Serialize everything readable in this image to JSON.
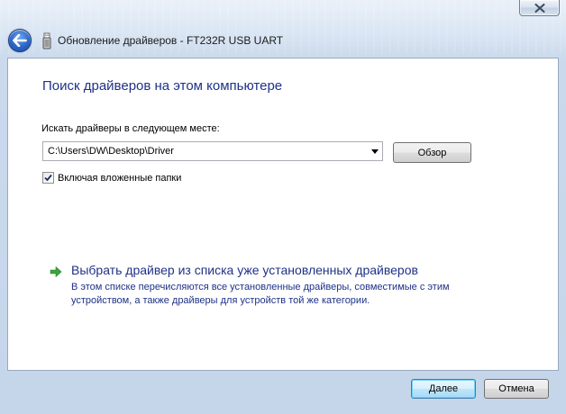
{
  "window": {
    "title": "Обновление драйверов - FT232R USB UART",
    "close_icon": "close-icon",
    "back_icon": "back-arrow-icon",
    "device_icon": "usb-device-icon"
  },
  "main": {
    "heading": "Поиск драйверов на этом компьютере",
    "path_label": "Искать драйверы в следующем месте:",
    "path_value": "C:\\Users\\DW\\Desktop\\Driver",
    "browse_label": "Обзор",
    "include_subfolders_label": "Включая вложенные папки",
    "include_subfolders_checked": true,
    "pick_link_title": "Выбрать драйвер из списка уже установленных драйверов",
    "pick_link_desc": "В этом списке перечисляются все установленные драйверы, совместимые с этим устройством, а также драйверы для устройств той же категории."
  },
  "footer": {
    "next_label": "Далее",
    "cancel_label": "Отмена"
  },
  "colors": {
    "heading": "#1e3287",
    "link_arrow": "#3aa33a",
    "frame": "#cad9ec"
  }
}
